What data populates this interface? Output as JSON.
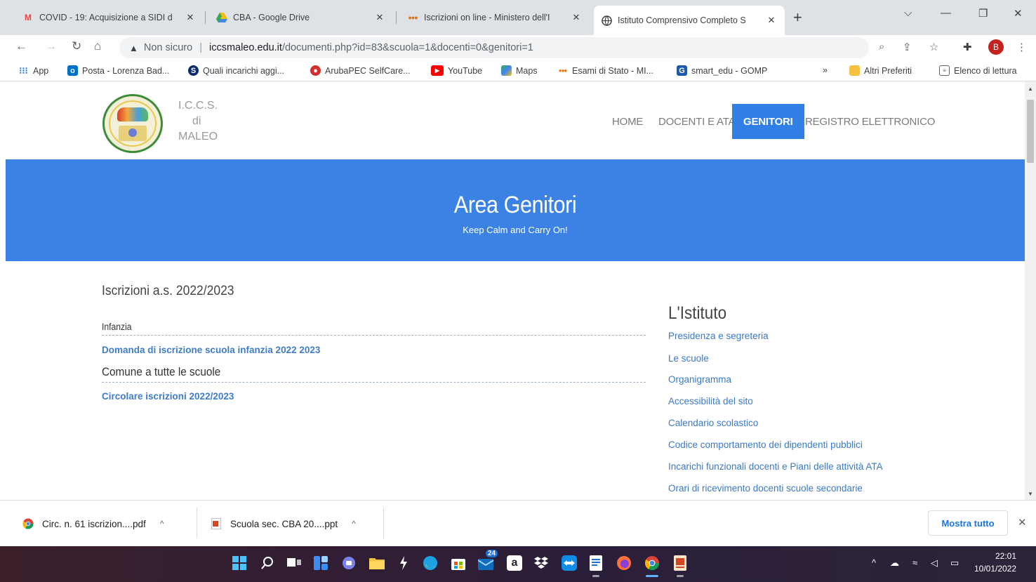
{
  "tabs": [
    {
      "title": "COVID - 19: Acquisizione a SIDI d",
      "icon": "gmail-icon"
    },
    {
      "title": "CBA - Google Drive",
      "icon": "google-drive-icon"
    },
    {
      "title": "Iscrizioni on line - Ministero dell'I",
      "icon": "ministero-icon"
    },
    {
      "title": "Istituto Comprensivo Completo S",
      "icon": "globe-icon",
      "active": true
    }
  ],
  "address": {
    "security": "Non sicuro",
    "domain": "iccsmaleo.edu.it",
    "path": "/documenti.php?id=83&scuola=1&docenti=0&genitori=1"
  },
  "profile_initial": "B",
  "bookmarks": [
    {
      "label": "App",
      "icon": "apps-grid-icon",
      "color": "#1a73e8"
    },
    {
      "label": "Posta - Lorenza Bad...",
      "icon": "outlook-icon",
      "color": "#0072c6"
    },
    {
      "label": "Quali incarichi aggi...",
      "icon": "skype-icon",
      "color": "#0a2a6b"
    },
    {
      "label": "ArubaPEC SelfCare...",
      "icon": "aruba-icon",
      "color": "#d32f2f"
    },
    {
      "label": "YouTube",
      "icon": "youtube-icon",
      "color": "#ff0000"
    },
    {
      "label": "Maps",
      "icon": "maps-icon",
      "color": "#34a853"
    },
    {
      "label": "Esami di Stato - MI...",
      "icon": "ministero-icon",
      "color": "#e8710a"
    },
    {
      "label": "smart_edu - GOMP",
      "icon": "gomp-icon",
      "color": "#1e5aa8"
    }
  ],
  "bookmarks_more": "»",
  "bookmarks_right": [
    {
      "label": "Altri Preferiti",
      "icon": "folder-icon"
    },
    {
      "label": "Elenco di lettura",
      "icon": "reading-list-icon"
    }
  ],
  "site": {
    "logo_lines": [
      "I.C.C.S.",
      "di",
      "MALEO"
    ],
    "nav": [
      "HOME",
      "DOCENTI E ATA",
      "GENITORI",
      "REGISTRO ELETTRONICO"
    ],
    "nav_active": "GENITORI",
    "hero_title": "Area Genitori",
    "hero_subtitle": "Keep Calm and Carry On!",
    "section_title": "Iscrizioni a.s. 2022/2023",
    "categories": [
      {
        "name": "Infanzia",
        "link": "Domanda di iscrizione scuola infanzia 2022 2023"
      },
      {
        "name": "Comune a tutte le scuole",
        "link": "Circolare iscrizioni 2022/2023"
      }
    ],
    "sidebar_title": "L'Istituto",
    "sidebar_links": [
      "Presidenza e segreteria",
      "Le scuole",
      "Organigramma",
      "Accessibilità del sito",
      "Calendario scolastico",
      "Codice comportamento dei dipendenti pubblici",
      "Incarichi funzionali docenti e Piani delle attività ATA",
      "Orari di ricevimento docenti scuole secondarie"
    ]
  },
  "downloads": [
    {
      "name": "Circ. n. 61 iscrizion....pdf",
      "icon": "chrome-pdf-icon"
    },
    {
      "name": "Scuola sec. CBA 20....ppt",
      "icon": "powerpoint-icon"
    }
  ],
  "downloads_show_all": "Mostra tutto",
  "taskbar": {
    "badge": "24",
    "time": "22:01",
    "date": "10/01/2022"
  },
  "colors": {
    "accent_blue": "#3b82e4",
    "link_blue": "#3a79c8",
    "nav_active_bg": "#2f7fe4"
  }
}
